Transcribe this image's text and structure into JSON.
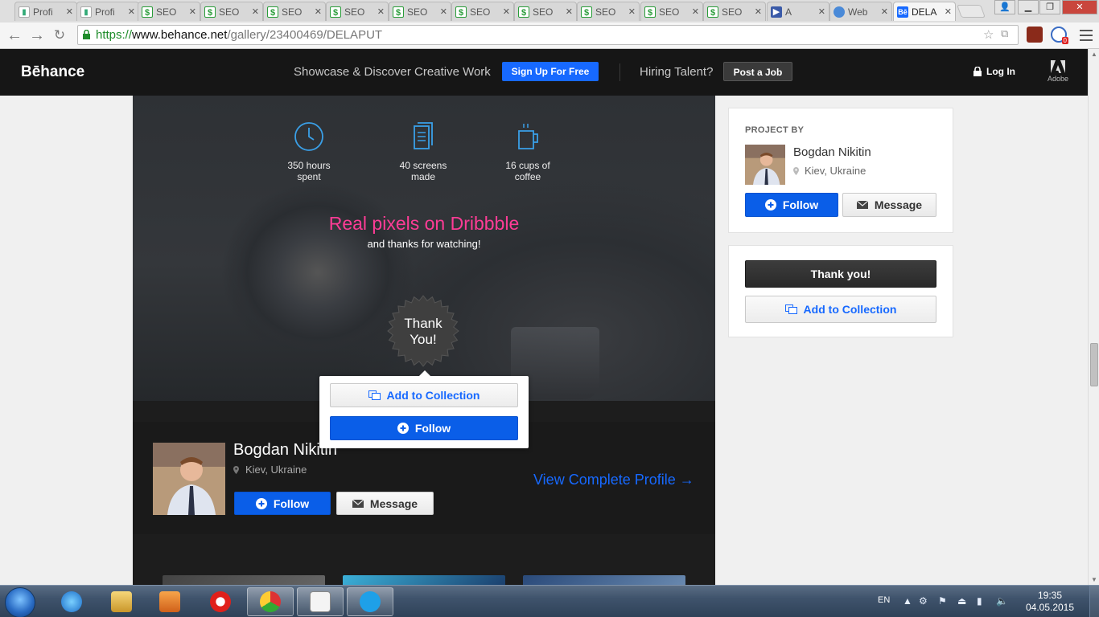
{
  "browser": {
    "tabs": [
      {
        "label": "Profi",
        "icon": "chart-favicon"
      },
      {
        "label": "Profi",
        "icon": "chart-favicon"
      },
      {
        "label": "SEO",
        "icon": "seo-favicon"
      },
      {
        "label": "SEO",
        "icon": "seo-favicon"
      },
      {
        "label": "SEO",
        "icon": "seo-favicon"
      },
      {
        "label": "SEO",
        "icon": "seo-favicon"
      },
      {
        "label": "SEO",
        "icon": "seo-favicon"
      },
      {
        "label": "SEO",
        "icon": "seo-favicon"
      },
      {
        "label": "SEO",
        "icon": "seo-favicon"
      },
      {
        "label": "SEO",
        "icon": "seo-favicon"
      },
      {
        "label": "SEO",
        "icon": "seo-favicon"
      },
      {
        "label": "SEO",
        "icon": "seo-favicon"
      },
      {
        "label": "A",
        "icon": "play-favicon"
      },
      {
        "label": "Web",
        "icon": "globe-favicon"
      },
      {
        "label": "DELA",
        "icon": "behance-favicon",
        "active": true
      }
    ],
    "url_scheme": "https://",
    "url_host": "www.behance.net",
    "url_path": "/gallery/23400469/DELAPUT",
    "notification_count": "0"
  },
  "header": {
    "logo": "Bēhance",
    "tagline": "Showcase & Discover Creative Work",
    "signup_label": "Sign Up For Free",
    "hiring_text": "Hiring Talent?",
    "post_job_label": "Post a Job",
    "login_label": "Log In",
    "adobe_label": "Adobe"
  },
  "project": {
    "stats": [
      {
        "icon": "clock-icon",
        "line1": "350 hours",
        "line2": "spent"
      },
      {
        "icon": "screens-icon",
        "line1": "40 screens",
        "line2": "made"
      },
      {
        "icon": "coffee-cup-icon",
        "line1": "16 cups of",
        "line2": "coffee"
      }
    ],
    "hero_title": "Real pixels on Dribbble",
    "hero_subtitle": "and thanks for watching!",
    "badge_line1": "Thank",
    "badge_line2": "You!",
    "popover": {
      "add_collection_label": "Add to Collection",
      "follow_label": "Follow"
    },
    "owner": {
      "name": "Bogdan Nikitin",
      "location": "Kiev, Ukraine",
      "follow_label": "Follow",
      "message_label": "Message",
      "view_profile_label": "View Complete Profile →"
    }
  },
  "sidebar": {
    "project_by_title": "PROJECT BY",
    "owner_name": "Bogdan Nikitin",
    "owner_location": "Kiev, Ukraine",
    "follow_label": "Follow",
    "message_label": "Message",
    "thank_you_label": "Thank you!",
    "add_collection_label": "Add to Collection"
  },
  "colors": {
    "behance_blue": "#1769ff",
    "hero_pink": "#ff3c96",
    "header_bg": "#161616"
  },
  "taskbar": {
    "language": "EN",
    "time": "19:35",
    "date": "04.05.2015"
  }
}
